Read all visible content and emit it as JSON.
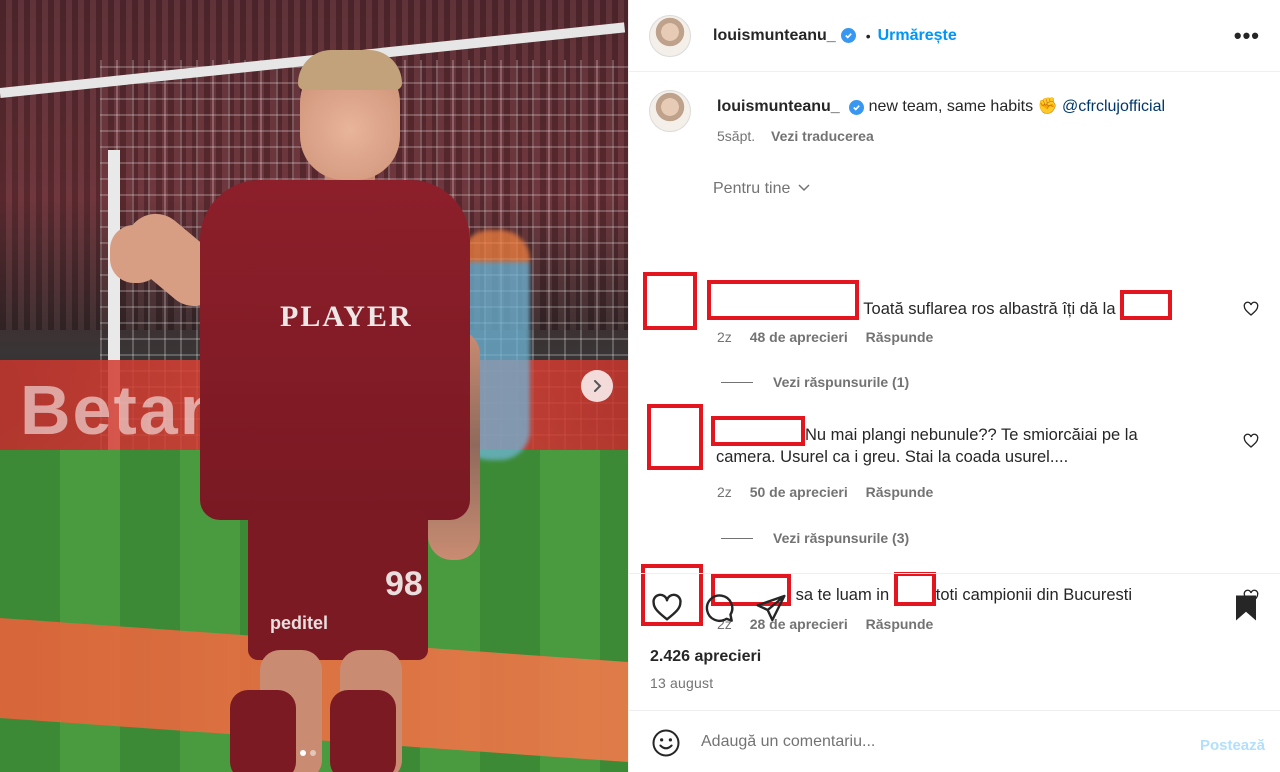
{
  "photo": {
    "sponsor": "PLAYER",
    "shorts_number": "98",
    "shorts_brand": "peditel",
    "banner_text": "Betano"
  },
  "header": {
    "username": "louismunteanu_",
    "separator": "•",
    "follow_label": "Urmărește",
    "more_label": "•••"
  },
  "caption": {
    "username": "louismunteanu_",
    "text": "new team, same habits",
    "emoji": "✊",
    "mention": "@cfrclujofficial",
    "age": "5săpt.",
    "translate_label": "Vezi traducerea"
  },
  "comments_header": "Pentru tine",
  "comments": [
    {
      "text": "Toată suflarea ros albastră îți dă la",
      "age": "2z",
      "likes": "48 de aprecieri",
      "reply": "Răspunde",
      "view_replies": "Vezi răspunsurile (1)"
    },
    {
      "text_line1": "Nu mai plangi nebunule?? Te smiorcăiai pe la",
      "text_line2": "camera. Usurel ca i greu. Stai la coada usurel....",
      "age": "2z",
      "likes": "50 de aprecieri",
      "reply": "Răspunde",
      "view_replies": "Vezi răspunsurile (3)"
    },
    {
      "text_before": "sa te luam in",
      "text_after": "toti campionii din Bucuresti",
      "age": "2z",
      "likes": "28 de aprecieri",
      "reply": "Răspunde"
    }
  ],
  "post": {
    "likes": "2.426 aprecieri",
    "date": "13 august"
  },
  "add_comment": {
    "placeholder": "Adaugă un comentariu...",
    "post_label": "Postează"
  },
  "colors": {
    "link": "#0095f6",
    "redaction": "#e3161f",
    "jersey": "#8c1f2a"
  },
  "icons": [
    "heart-icon",
    "comment-icon",
    "share-icon",
    "bookmark-icon",
    "emoji-icon",
    "verified-icon",
    "chevron-down-icon",
    "chevron-right-icon"
  ]
}
